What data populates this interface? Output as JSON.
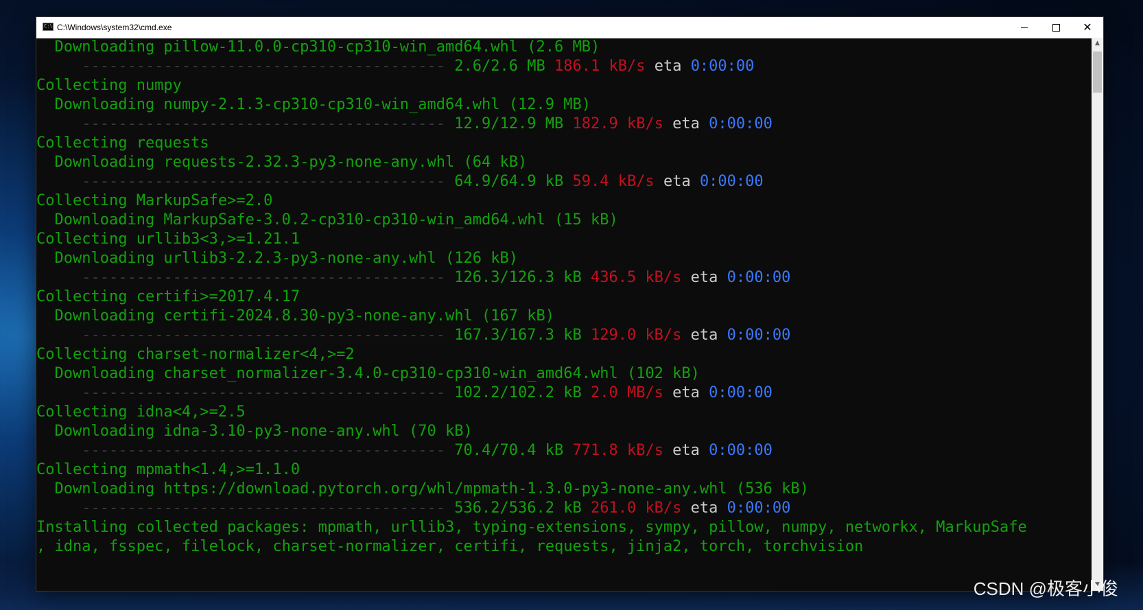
{
  "window": {
    "title": "C:\\Windows\\system32\\cmd.exe",
    "icon_text": "C:\\"
  },
  "controls": {
    "minimize": "minimize",
    "maximize": "maximize",
    "close": "✕"
  },
  "console_lines": [
    [
      {
        "t": "  Downloading pillow-11.0.0-cp310-cp310-win_amd64.whl (2.6 MB)",
        "c": "g"
      }
    ],
    [
      {
        "t": "     ",
        "c": "w"
      },
      {
        "t": "----------------------------------------",
        "c": "bar"
      },
      {
        "t": " 2.6/2.6 MB ",
        "c": "g"
      },
      {
        "t": "186.1 kB/s",
        "c": "r"
      },
      {
        "t": " eta ",
        "c": "w"
      },
      {
        "t": "0:00:00",
        "c": "b"
      }
    ],
    [
      {
        "t": "Collecting numpy",
        "c": "g"
      }
    ],
    [
      {
        "t": "  Downloading numpy-2.1.3-cp310-cp310-win_amd64.whl (12.9 MB)",
        "c": "g"
      }
    ],
    [
      {
        "t": "     ",
        "c": "w"
      },
      {
        "t": "----------------------------------------",
        "c": "bar"
      },
      {
        "t": " 12.9/12.9 MB ",
        "c": "g"
      },
      {
        "t": "182.9 kB/s",
        "c": "r"
      },
      {
        "t": " eta ",
        "c": "w"
      },
      {
        "t": "0:00:00",
        "c": "b"
      }
    ],
    [
      {
        "t": "Collecting requests",
        "c": "g"
      }
    ],
    [
      {
        "t": "  Downloading requests-2.32.3-py3-none-any.whl (64 kB)",
        "c": "g"
      }
    ],
    [
      {
        "t": "     ",
        "c": "w"
      },
      {
        "t": "----------------------------------------",
        "c": "bar"
      },
      {
        "t": " 64.9/64.9 kB ",
        "c": "g"
      },
      {
        "t": "59.4 kB/s",
        "c": "r"
      },
      {
        "t": " eta ",
        "c": "w"
      },
      {
        "t": "0:00:00",
        "c": "b"
      }
    ],
    [
      {
        "t": "Collecting MarkupSafe>=2.0",
        "c": "g"
      }
    ],
    [
      {
        "t": "  Downloading MarkupSafe-3.0.2-cp310-cp310-win_amd64.whl (15 kB)",
        "c": "g"
      }
    ],
    [
      {
        "t": "Collecting urllib3<3,>=1.21.1",
        "c": "g"
      }
    ],
    [
      {
        "t": "  Downloading urllib3-2.2.3-py3-none-any.whl (126 kB)",
        "c": "g"
      }
    ],
    [
      {
        "t": "     ",
        "c": "w"
      },
      {
        "t": "----------------------------------------",
        "c": "bar"
      },
      {
        "t": " 126.3/126.3 kB ",
        "c": "g"
      },
      {
        "t": "436.5 kB/s",
        "c": "r"
      },
      {
        "t": " eta ",
        "c": "w"
      },
      {
        "t": "0:00:00",
        "c": "b"
      }
    ],
    [
      {
        "t": "Collecting certifi>=2017.4.17",
        "c": "g"
      }
    ],
    [
      {
        "t": "  Downloading certifi-2024.8.30-py3-none-any.whl (167 kB)",
        "c": "g"
      }
    ],
    [
      {
        "t": "     ",
        "c": "w"
      },
      {
        "t": "----------------------------------------",
        "c": "bar"
      },
      {
        "t": " 167.3/167.3 kB ",
        "c": "g"
      },
      {
        "t": "129.0 kB/s",
        "c": "r"
      },
      {
        "t": " eta ",
        "c": "w"
      },
      {
        "t": "0:00:00",
        "c": "b"
      }
    ],
    [
      {
        "t": "Collecting charset-normalizer<4,>=2",
        "c": "g"
      }
    ],
    [
      {
        "t": "  Downloading charset_normalizer-3.4.0-cp310-cp310-win_amd64.whl (102 kB)",
        "c": "g"
      }
    ],
    [
      {
        "t": "     ",
        "c": "w"
      },
      {
        "t": "----------------------------------------",
        "c": "bar"
      },
      {
        "t": " 102.2/102.2 kB ",
        "c": "g"
      },
      {
        "t": "2.0 MB/s",
        "c": "r"
      },
      {
        "t": " eta ",
        "c": "w"
      },
      {
        "t": "0:00:00",
        "c": "b"
      }
    ],
    [
      {
        "t": "Collecting idna<4,>=2.5",
        "c": "g"
      }
    ],
    [
      {
        "t": "  Downloading idna-3.10-py3-none-any.whl (70 kB)",
        "c": "g"
      }
    ],
    [
      {
        "t": "     ",
        "c": "w"
      },
      {
        "t": "----------------------------------------",
        "c": "bar"
      },
      {
        "t": " 70.4/70.4 kB ",
        "c": "g"
      },
      {
        "t": "771.8 kB/s",
        "c": "r"
      },
      {
        "t": " eta ",
        "c": "w"
      },
      {
        "t": "0:00:00",
        "c": "b"
      }
    ],
    [
      {
        "t": "Collecting mpmath<1.4,>=1.1.0",
        "c": "g"
      }
    ],
    [
      {
        "t": "  Downloading https://download.pytorch.org/whl/mpmath-1.3.0-py3-none-any.whl (536 kB)",
        "c": "g"
      }
    ],
    [
      {
        "t": "     ",
        "c": "w"
      },
      {
        "t": "----------------------------------------",
        "c": "bar"
      },
      {
        "t": " 536.2/536.2 kB ",
        "c": "g"
      },
      {
        "t": "261.0 kB/s",
        "c": "r"
      },
      {
        "t": " eta ",
        "c": "w"
      },
      {
        "t": "0:00:00",
        "c": "b"
      }
    ],
    [
      {
        "t": "Installing collected packages: mpmath, urllib3, typing-extensions, sympy, pillow, numpy, networkx, MarkupSafe",
        "c": "g"
      }
    ],
    [
      {
        "t": ", idna, fsspec, filelock, charset-normalizer, certifi, requests, jinja2, torch, torchvision",
        "c": "g"
      }
    ]
  ],
  "colors": {
    "green": "#13a10e",
    "red": "#c50f1f",
    "blue": "#3b78ff",
    "white": "#cccccc",
    "progress_bar": "#3a3a3a",
    "background": "#0c0c0c"
  },
  "scrollbar": {
    "up": "▲",
    "down": "▼"
  },
  "watermark": "CSDN @极客小俊"
}
